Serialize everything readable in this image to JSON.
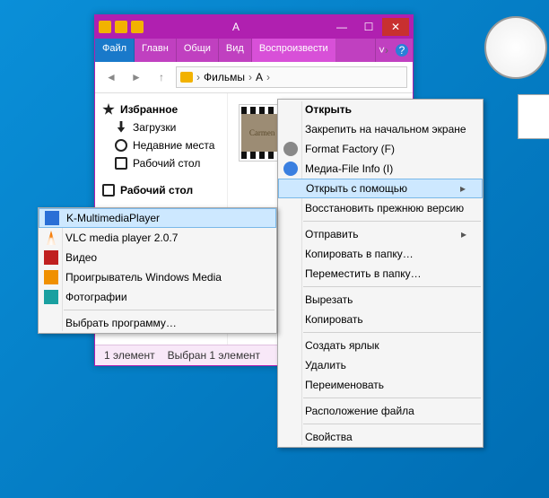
{
  "window": {
    "title": "A",
    "ribbon": {
      "file": "Файл",
      "home": "Главн",
      "share": "Общи",
      "view": "Вид",
      "play": "Воспроизвести"
    },
    "breadcrumb": [
      "Фильмы",
      "A"
    ],
    "status": {
      "count": "1 элемент",
      "selected": "Выбран 1 элемент"
    }
  },
  "nav": {
    "favorites": "Избранное",
    "downloads": "Загрузки",
    "recent": "Недавние места",
    "desktop": "Рабочий стол",
    "desktop2": "Рабочий стол"
  },
  "thumb": {
    "caption": "Carmen Plumb"
  },
  "ctx": {
    "open": "Открыть",
    "pin": "Закрепить на начальном экране",
    "format": "Format Factory (F)",
    "media_info": "Медиа-File Info (I)",
    "open_with": "Открыть с помощью",
    "restore": "Восстановить прежнюю версию",
    "send_to": "Отправить",
    "copy_to": "Копировать в папку…",
    "move_to": "Переместить в папку…",
    "cut": "Вырезать",
    "copy": "Копировать",
    "shortcut": "Создать ярлык",
    "delete": "Удалить",
    "rename": "Переименовать",
    "location": "Расположение файла",
    "props": "Свойства"
  },
  "openwith": {
    "km": "K-MultimediaPlayer",
    "vlc": "VLC media player 2.0.7",
    "video": "Видео",
    "wmp": "Проигрыватель Windows Media",
    "photos": "Фотографии",
    "choose": "Выбрать программу…"
  }
}
